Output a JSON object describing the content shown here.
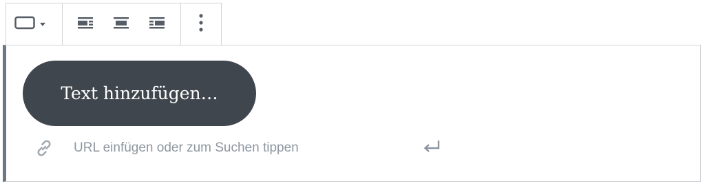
{
  "toolbar": {
    "block_type_icon": "button-block-icon",
    "dropdown_icon": "caret-down-icon",
    "alignment_icons": [
      "align-left-icon",
      "align-center-icon",
      "align-right-icon"
    ],
    "more_icon": "more-vertical-icon"
  },
  "button": {
    "placeholder": "Text hinzufügen…"
  },
  "url": {
    "placeholder": "URL einfügen oder zum Suchen tippen",
    "value": "",
    "link_icon": "link-icon",
    "submit_icon": "enter-arrow-icon"
  },
  "colors": {
    "button_bg": "#40464d",
    "button_text": "#ffffff",
    "border": "#d0d3d6",
    "selected_bar": "#6c7781",
    "icon": "#555d66",
    "placeholder": "#8d96a0"
  }
}
